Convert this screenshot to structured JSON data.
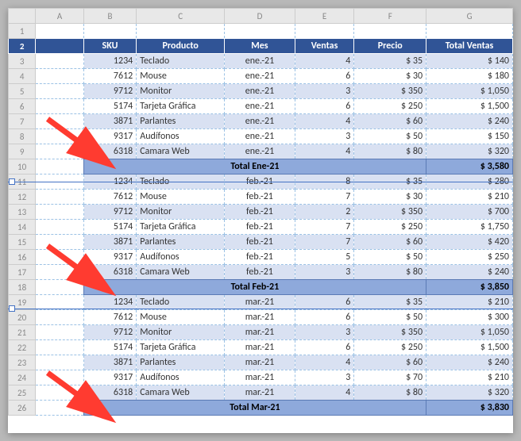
{
  "cols": [
    "A",
    "B",
    "C",
    "D",
    "E",
    "F",
    "G"
  ],
  "headers": {
    "sku": "SKU",
    "producto": "Producto",
    "mes": "Mes",
    "ventas": "Ventas",
    "precio": "Precio",
    "total": "Total Ventas"
  },
  "groups": [
    {
      "total_label": "Total Ene-21",
      "total_value": "$ 3,580",
      "rows": [
        {
          "sku": "1234",
          "producto": "Teclado",
          "mes": "ene.-21",
          "ventas": "4",
          "precio": "$ 35",
          "total": "$ 140"
        },
        {
          "sku": "7612",
          "producto": "Mouse",
          "mes": "ene.-21",
          "ventas": "6",
          "precio": "$ 30",
          "total": "$ 180"
        },
        {
          "sku": "9712",
          "producto": "Monitor",
          "mes": "ene.-21",
          "ventas": "3",
          "precio": "$ 350",
          "total": "$ 1,050"
        },
        {
          "sku": "5174",
          "producto": "Tarjeta Gráfica",
          "mes": "ene.-21",
          "ventas": "6",
          "precio": "$ 250",
          "total": "$ 1,500"
        },
        {
          "sku": "3871",
          "producto": "Parlantes",
          "mes": "ene.-21",
          "ventas": "4",
          "precio": "$ 60",
          "total": "$ 240"
        },
        {
          "sku": "9317",
          "producto": "Audífonos",
          "mes": "ene.-21",
          "ventas": "3",
          "precio": "$ 50",
          "total": "$ 150"
        },
        {
          "sku": "6318",
          "producto": "Camara Web",
          "mes": "ene.-21",
          "ventas": "4",
          "precio": "$ 80",
          "total": "$ 320"
        }
      ]
    },
    {
      "total_label": "Total Feb-21",
      "total_value": "$ 3,850",
      "rows": [
        {
          "sku": "1234",
          "producto": "Teclado",
          "mes": "feb.-21",
          "ventas": "8",
          "precio": "$ 35",
          "total": "$ 280"
        },
        {
          "sku": "7612",
          "producto": "Mouse",
          "mes": "feb.-21",
          "ventas": "7",
          "precio": "$ 30",
          "total": "$ 210"
        },
        {
          "sku": "9712",
          "producto": "Monitor",
          "mes": "feb.-21",
          "ventas": "2",
          "precio": "$ 350",
          "total": "$ 700"
        },
        {
          "sku": "5174",
          "producto": "Tarjeta Gráfica",
          "mes": "feb.-21",
          "ventas": "7",
          "precio": "$ 250",
          "total": "$ 1,750"
        },
        {
          "sku": "3871",
          "producto": "Parlantes",
          "mes": "feb.-21",
          "ventas": "7",
          "precio": "$ 60",
          "total": "$ 420"
        },
        {
          "sku": "9317",
          "producto": "Audífonos",
          "mes": "feb.-21",
          "ventas": "5",
          "precio": "$ 50",
          "total": "$ 250"
        },
        {
          "sku": "6318",
          "producto": "Camara Web",
          "mes": "feb.-21",
          "ventas": "3",
          "precio": "$ 80",
          "total": "$ 240"
        }
      ]
    },
    {
      "total_label": "Total Mar-21",
      "total_value": "$ 3,830",
      "rows": [
        {
          "sku": "1234",
          "producto": "Teclado",
          "mes": "mar.-21",
          "ventas": "6",
          "precio": "$ 35",
          "total": "$ 210"
        },
        {
          "sku": "7612",
          "producto": "Mouse",
          "mes": "mar.-21",
          "ventas": "6",
          "precio": "$ 50",
          "total": "$ 300"
        },
        {
          "sku": "9712",
          "producto": "Monitor",
          "mes": "mar.-21",
          "ventas": "3",
          "precio": "$ 350",
          "total": "$ 1,050"
        },
        {
          "sku": "5174",
          "producto": "Tarjeta Gráfica",
          "mes": "mar.-21",
          "ventas": "6",
          "precio": "$ 250",
          "total": "$ 1,500"
        },
        {
          "sku": "3871",
          "producto": "Parlantes",
          "mes": "mar.-21",
          "ventas": "4",
          "precio": "$ 60",
          "total": "$ 240"
        },
        {
          "sku": "9317",
          "producto": "Audífonos",
          "mes": "mar.-21",
          "ventas": "3",
          "precio": "$ 70",
          "total": "$ 210"
        },
        {
          "sku": "6318",
          "producto": "Camara Web",
          "mes": "mar.-21",
          "ventas": "4",
          "precio": "$ 80",
          "total": "$ 320"
        }
      ]
    }
  ]
}
